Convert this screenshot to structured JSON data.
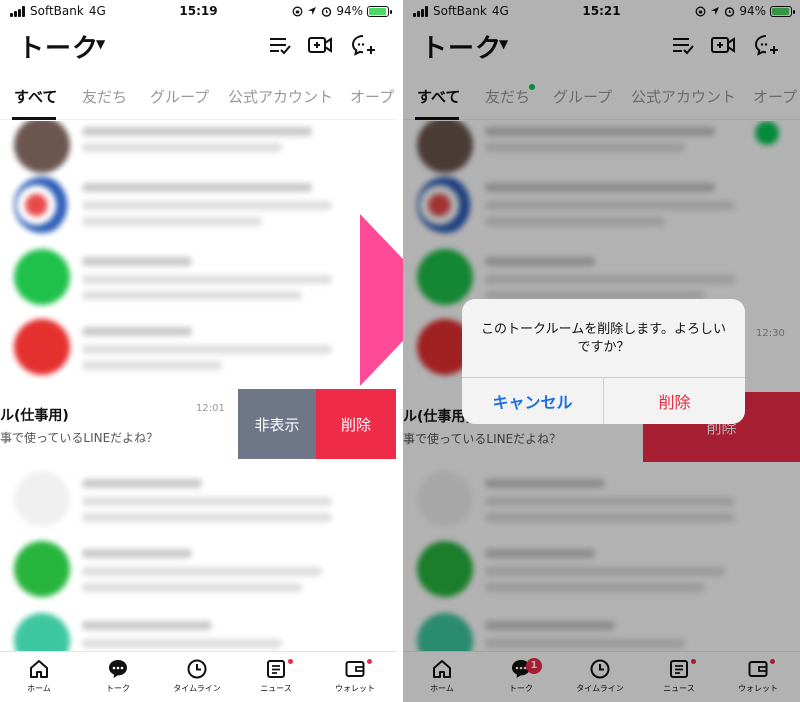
{
  "status_left": {
    "carrier": "SoftBank",
    "network": "4G",
    "time": "15:19",
    "battery": "94%"
  },
  "status_right": {
    "carrier": "SoftBank",
    "network": "4G",
    "time": "15:21",
    "battery": "94%"
  },
  "header": {
    "title": "トーク"
  },
  "tabs": [
    "すべて",
    "友だち",
    "グループ",
    "公式アカウント",
    "オープ"
  ],
  "swipe_row": {
    "name": "ル(仕事用)",
    "message": "事で使っているLINEだよね？",
    "time": "12:01",
    "hide_label": "非表示",
    "delete_label": "削除"
  },
  "right_row": {
    "name": "ル(仕事用)",
    "message": "事で使っているLINEだよね？",
    "time": "12:30",
    "delete_label": "削除"
  },
  "dialog": {
    "message": "このトークルームを削除します。よろしいですか？",
    "cancel_label": "キャンセル",
    "delete_label": "削除"
  },
  "nav": {
    "items": [
      {
        "label": "ホーム",
        "icon": "home-icon"
      },
      {
        "label": "トーク",
        "icon": "chat-icon"
      },
      {
        "label": "タイムライン",
        "icon": "clock-icon"
      },
      {
        "label": "ニュース",
        "icon": "news-icon"
      },
      {
        "label": "ウォレット",
        "icon": "wallet-icon"
      }
    ],
    "talk_badge": "1"
  },
  "colors": {
    "line_green": "#06c755",
    "delete_red": "#ee2b48",
    "hide_gray": "#6f7688",
    "dialog_blue": "#1f6fe0",
    "arrow_pink": "#ff4a97"
  }
}
